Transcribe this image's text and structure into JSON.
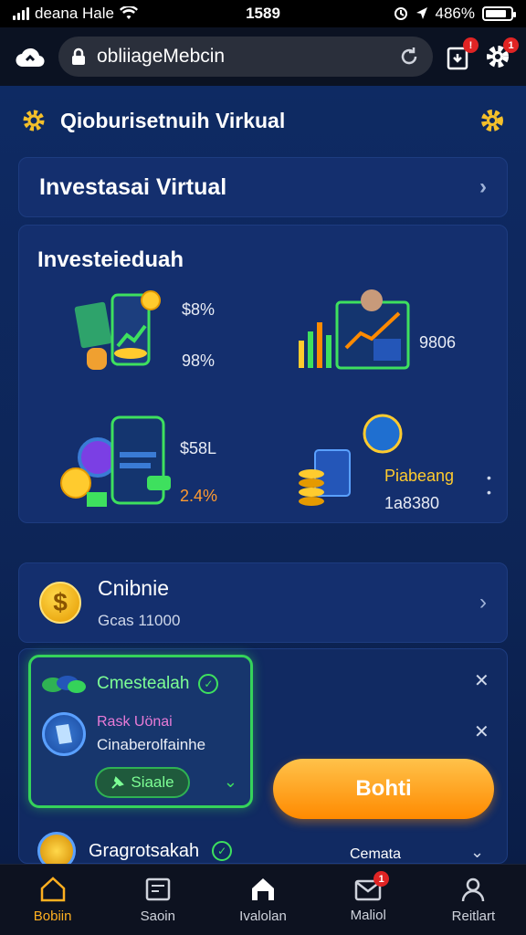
{
  "status": {
    "carrier": "deana Hale",
    "time": "1589",
    "battery": "486%",
    "battery_fill": 0.86
  },
  "browser": {
    "url": "obliiageMebcin",
    "tab_badge": "!",
    "settings_badge": "1"
  },
  "app": {
    "title": "Qioburisetnuih Virkual"
  },
  "virtual_card": {
    "label": "Investasai Virtual"
  },
  "invest_card": {
    "heading": "Investeieduah",
    "items": [
      {
        "line1": "$8%",
        "line2": "98%"
      },
      {
        "line1": "9806"
      },
      {
        "line1": "$58L",
        "line2": "2.4%"
      },
      {
        "line1": "Piabeang",
        "line2": "1a8380"
      }
    ]
  },
  "balance_card": {
    "title": "Cnibnie",
    "value": "Gcas 11000",
    "coin_symbol": "$"
  },
  "task_card": {
    "header": "Cmestealah",
    "sub_a": "Rask Uönai",
    "sub_b": "Cinaberolfainhe",
    "pill": "Siaale",
    "action": "Bohti",
    "row2_title": "Gragrotsakah",
    "row2_right": "Cemata"
  },
  "tabs": [
    {
      "label": "Bobiin",
      "active": true
    },
    {
      "label": "Saoin"
    },
    {
      "label": "Ivalolan"
    },
    {
      "label": "Maliol",
      "badge": "1"
    },
    {
      "label": "Reitlart"
    }
  ],
  "colors": {
    "accent": "#ffb020",
    "bg": "#0e2a63",
    "green": "#35d35a",
    "orange": "#ff8a00"
  }
}
